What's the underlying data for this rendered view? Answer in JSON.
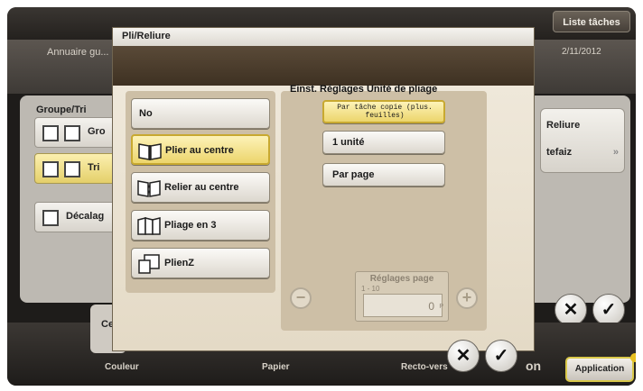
{
  "background": {
    "topbar": {
      "list_button": "Liste tâches",
      "left_fragment": "Annuaire gu...",
      "date": "2/11/2012"
    },
    "group_label": "Groupe/Tri",
    "mini_buttons": [
      {
        "label": "Gro",
        "selected": false
      },
      {
        "label": "Tri",
        "selected": true
      },
      {
        "label": "Décalag",
        "selected": false
      }
    ],
    "right_panel": {
      "item1": "Reliure",
      "item2": "tefaiz",
      "arrow": "»"
    },
    "bottom_bar": {
      "labels": [
        "Couleur",
        "Papier",
        "Recto-vers",
        "on"
      ],
      "tile_label": "Ce",
      "application_button": "Application"
    },
    "cancel_symbol": "✕",
    "ok_symbol": "✓"
  },
  "dialog": {
    "title": "Pli/Reliure",
    "left_options": [
      {
        "label": "No",
        "icon": "none",
        "selected": false
      },
      {
        "label": "Plier au centre",
        "icon": "fold-center-icon",
        "selected": true
      },
      {
        "label": "Relier au centre",
        "icon": "bind-center-icon",
        "selected": false
      },
      {
        "label": "Pliage en 3",
        "icon": "tri-fold-icon",
        "selected": false
      },
      {
        "label": "PlienZ",
        "icon": "z-fold-icon",
        "selected": false
      }
    ],
    "right_title": "Einst. Réglages Unité de pliage",
    "unit_options": [
      {
        "label": "Par tâche copie (plus. feuilles)",
        "selected": true
      },
      {
        "label": "1 unité",
        "selected": false
      },
      {
        "label": "Par page",
        "selected": false
      }
    ],
    "page_settings": {
      "title": "Réglages page",
      "range": "1 - 10",
      "value": "0",
      "unit": "P",
      "minus": "−",
      "plus": "+"
    },
    "cancel_symbol": "✕",
    "ok_symbol": "✓"
  },
  "colors": {
    "accent_yellow": "#ecd56c",
    "dialog_brown": "#4a3b2a",
    "panel_tan": "#cdbfa6"
  }
}
